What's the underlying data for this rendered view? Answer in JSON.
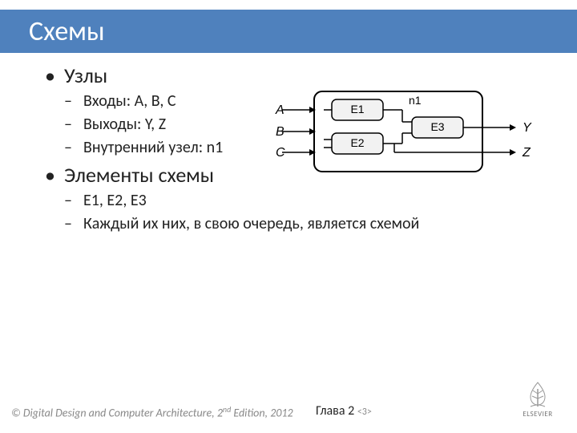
{
  "title": "Схемы",
  "bullets": {
    "nodes": {
      "heading": "Узлы",
      "items": {
        "inputs": "Входы: A, B, C",
        "outputs": "Выходы: Y, Z",
        "internal": "Внутренний узел: n1"
      }
    },
    "elements": {
      "heading": "Элементы схемы",
      "items": {
        "list": "E1, E2, E3",
        "note": "Каждый их них, в свою очередь, является схемой"
      }
    }
  },
  "diagram": {
    "labels": {
      "A": "A",
      "B": "B",
      "C": "C",
      "Y": "Y",
      "Z": "Z",
      "n1": "n1"
    },
    "elements": {
      "E1": "E1",
      "E2": "E2",
      "E3": "E3"
    }
  },
  "footer": {
    "copyright_pre": "© Digital Design and Computer Architecture, 2",
    "copyright_sup": "nd",
    "copyright_post": " Edition, 2012",
    "chapter": "Глава 2 ",
    "slidenum": "<3>",
    "publisher": "ELSEVIER"
  }
}
